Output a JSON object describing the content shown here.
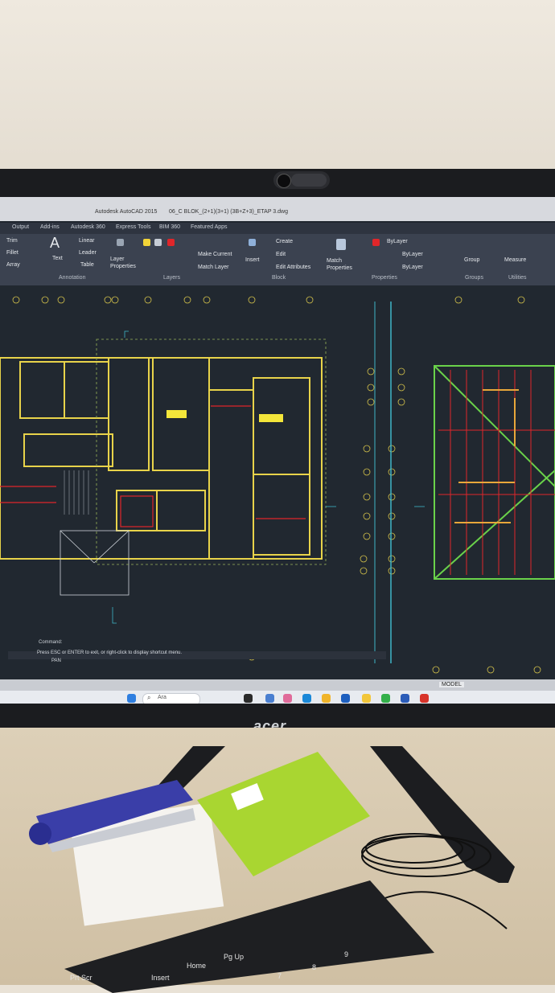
{
  "window": {
    "app_title": "Autodesk AutoCAD 2015",
    "file_title": "06_C BLOK_(2+1)(3+1) (3B+Z+3)_ETAP 3.dwg"
  },
  "tabs": [
    "Output",
    "Add-ins",
    "Autodesk 360",
    "Express Tools",
    "BIM 360",
    "Featured Apps"
  ],
  "ribbon": {
    "trim": "Trim",
    "fillet": "Fillet",
    "array": "Array",
    "text": "Text",
    "linear": "Linear",
    "leader": "Leader",
    "table": "Table",
    "annotation_group": "Annotation",
    "layer_properties": "Layer Properties",
    "make_current": "Make Current",
    "match_layer": "Match Layer",
    "layers_group": "Layers",
    "insert": "Insert",
    "create": "Create",
    "edit": "Edit",
    "edit_attributes": "Edit Attributes",
    "block_group": "Block",
    "match_properties": "Match Properties",
    "bylayer_1": "ByLayer",
    "bylayer_2": "ByLayer",
    "bylayer_3": "ByLayer",
    "properties_group": "Properties",
    "group": "Group",
    "groups_group": "Groups",
    "measure": "Measure",
    "utilities_group": "Utilities"
  },
  "command": {
    "label": "Command:",
    "prompt": "Press ESC or ENTER to exit, or right-click to display shortcut menu.",
    "input": "PAN"
  },
  "status": {
    "model_tab": "MODEL"
  },
  "taskbar": {
    "search_placeholder": "Ara"
  },
  "monitor": {
    "brand": "acer"
  },
  "keyboard": {
    "keys": [
      "Prt Scr",
      "Insert",
      "Home",
      "Pg Up",
      "7",
      "8",
      "9"
    ]
  },
  "colors": {
    "drawing_bg": "#212830",
    "ribbon_bg": "#3b4250",
    "wall_line": "#e8d34a",
    "stapler": "#3a3ea8",
    "packet": "#a9d631"
  }
}
